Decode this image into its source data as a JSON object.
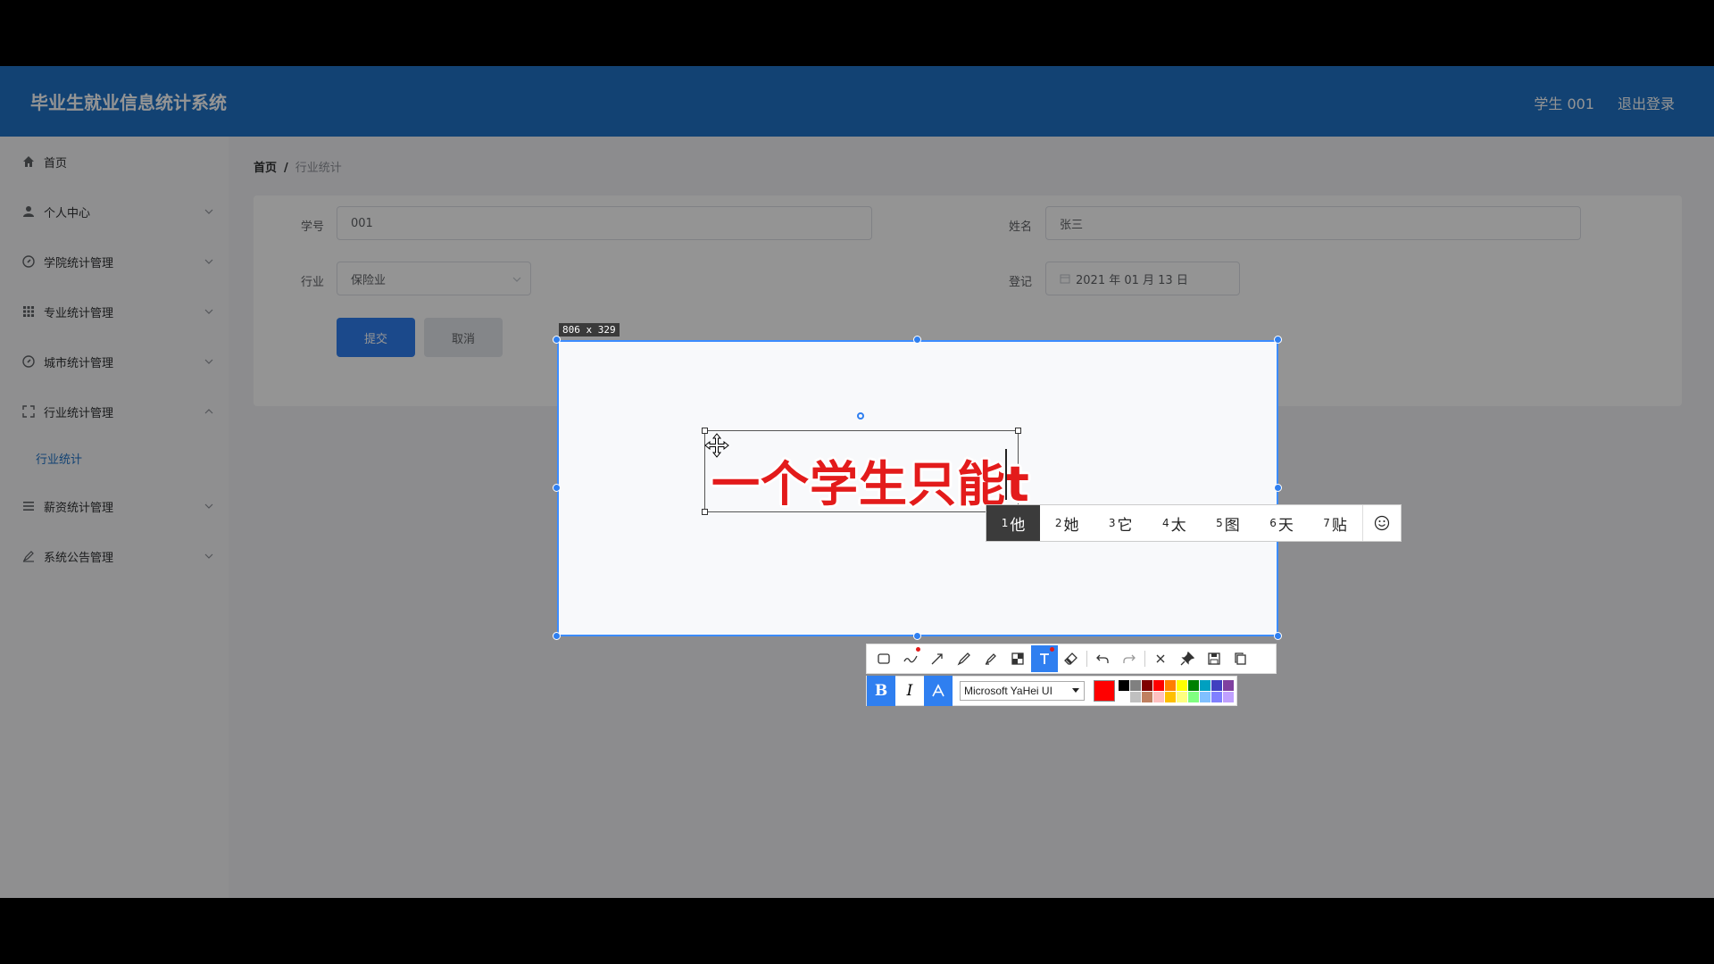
{
  "header": {
    "title": "毕业生就业信息统计系统",
    "user": "学生 001",
    "logout": "退出登录"
  },
  "sidebar": {
    "items": [
      {
        "label": "首页",
        "icon": "home-icon",
        "expandable": false
      },
      {
        "label": "个人中心",
        "icon": "user-icon",
        "expandable": true
      },
      {
        "label": "学院统计管理",
        "icon": "compass-icon",
        "expandable": true
      },
      {
        "label": "专业统计管理",
        "icon": "grid-icon",
        "expandable": true
      },
      {
        "label": "城市统计管理",
        "icon": "compass-icon",
        "expandable": true
      },
      {
        "label": "行业统计管理",
        "icon": "fullscreen-icon",
        "expandable": true
      },
      {
        "label": "薪资统计管理",
        "icon": "list-icon",
        "expandable": true
      },
      {
        "label": "系统公告管理",
        "icon": "edit-icon",
        "expandable": true
      }
    ],
    "subitem": "行业统计"
  },
  "breadcrumb": {
    "home": "首页",
    "separator": "/",
    "current": "行业统计"
  },
  "form": {
    "student_id_label": "学号",
    "student_id_value": "001",
    "name_label": "姓名",
    "name_value": "张三",
    "industry_label": "行业",
    "industry_value": "保险业",
    "register_label": "登记",
    "register_value": "2021 年 01 月 13 日",
    "submit": "提交",
    "cancel": "取消"
  },
  "screenshot_tool": {
    "size_label": "806 x 329",
    "annotation_text": "一个学生只能t",
    "ime_candidates": [
      {
        "num": "1",
        "text": "他"
      },
      {
        "num": "2",
        "text": "她"
      },
      {
        "num": "3",
        "text": "它"
      },
      {
        "num": "4",
        "text": "太"
      },
      {
        "num": "5",
        "text": "图"
      },
      {
        "num": "6",
        "text": "天"
      },
      {
        "num": "7",
        "text": "贴"
      }
    ],
    "font_name": "Microsoft YaHei UI",
    "current_color": "#ff0000",
    "palette": [
      "#000000",
      "#808080",
      "#800000",
      "#ff0000",
      "#ff8000",
      "#ffff00",
      "#008000",
      "#00a0c0",
      "#4040c0",
      "#8040a0",
      "#ffffff",
      "#c0c0c0",
      "#c08060",
      "#ffc0c0",
      "#ffc000",
      "#ffff80",
      "#80ff80",
      "#80c0ff",
      "#8080ff",
      "#c0a0ff"
    ],
    "accent": "#2f7ff0"
  }
}
